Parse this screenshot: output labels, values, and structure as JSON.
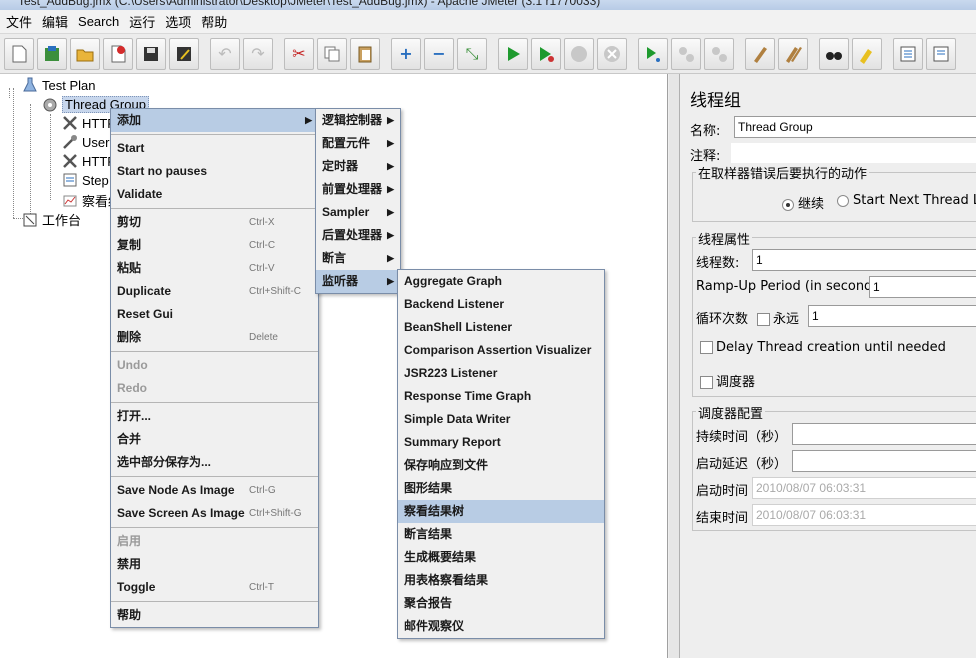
{
  "window": {
    "title": "Test_AddBug.jmx (C:\\Users\\Administrator\\Desktop\\JMeter\\Test_AddBug.jmx) - Apache JMeter (3.1 r1770033)"
  },
  "menubar": [
    "文件",
    "编辑",
    "Search",
    "运行",
    "选项",
    "帮助"
  ],
  "toolbar_icons": [
    "new-icon",
    "templates-icon",
    "open-icon",
    "close-icon",
    "save-icon",
    "save-as-icon",
    "undo-icon",
    "redo-icon",
    "cut-icon",
    "copy-icon",
    "paste-icon",
    "expand-icon",
    "collapse-icon",
    "toggle-icon",
    "start-icon",
    "start-no-pauses-icon",
    "stop-icon",
    "shutdown-icon",
    "remote-start-icon",
    "remote-stop-icon",
    "remote-shutdown-icon",
    "clear-icon",
    "clear-all-icon",
    "search-icon",
    "reset-search-icon",
    "function-helper-icon",
    "help-icon"
  ],
  "tree": {
    "test_plan": "Test Plan",
    "thread_group": "Thread Group",
    "children": [
      "HTTP",
      "User",
      "HTTP",
      "Step",
      "察看结"
    ],
    "workbench": "工作台"
  },
  "context_menu": {
    "items": [
      {
        "label": "添加",
        "submenu": true,
        "highlighted": true
      },
      {
        "sep": true
      },
      {
        "label": "Start"
      },
      {
        "label": "Start no pauses"
      },
      {
        "label": "Validate"
      },
      {
        "sep": true
      },
      {
        "label": "剪切",
        "shortcut": "Ctrl-X"
      },
      {
        "label": "复制",
        "shortcut": "Ctrl-C"
      },
      {
        "label": "粘贴",
        "shortcut": "Ctrl-V"
      },
      {
        "label": "Duplicate",
        "shortcut": "Ctrl+Shift-C"
      },
      {
        "label": "Reset Gui"
      },
      {
        "label": "删除",
        "shortcut": "Delete"
      },
      {
        "sep": true
      },
      {
        "label": "Undo",
        "disabled": true
      },
      {
        "label": "Redo",
        "disabled": true
      },
      {
        "sep": true
      },
      {
        "label": "打开..."
      },
      {
        "label": "合并"
      },
      {
        "label": "选中部分保存为..."
      },
      {
        "sep": true
      },
      {
        "label": "Save Node As Image",
        "shortcut": "Ctrl-G"
      },
      {
        "label": "Save Screen As Image",
        "shortcut": "Ctrl+Shift-G"
      },
      {
        "sep": true
      },
      {
        "label": "启用",
        "disabled": true
      },
      {
        "label": "禁用"
      },
      {
        "label": "Toggle",
        "shortcut": "Ctrl-T"
      },
      {
        "sep": true
      },
      {
        "label": "帮助"
      }
    ]
  },
  "add_submenu": {
    "items": [
      {
        "label": "逻辑控制器",
        "submenu": true
      },
      {
        "label": "配置元件",
        "submenu": true
      },
      {
        "label": "定时器",
        "submenu": true
      },
      {
        "label": "前置处理器",
        "submenu": true
      },
      {
        "label": "Sampler",
        "submenu": true
      },
      {
        "label": "后置处理器",
        "submenu": true
      },
      {
        "label": "断言",
        "submenu": true
      },
      {
        "label": "监听器",
        "submenu": true,
        "highlighted": true
      }
    ]
  },
  "listener_submenu": {
    "items": [
      {
        "label": "Aggregate Graph"
      },
      {
        "label": "Backend Listener"
      },
      {
        "label": "BeanShell Listener"
      },
      {
        "label": "Comparison Assertion Visualizer"
      },
      {
        "label": "JSR223 Listener"
      },
      {
        "label": "Response Time Graph"
      },
      {
        "label": "Simple Data Writer"
      },
      {
        "label": "Summary Report"
      },
      {
        "label": "保存响应到文件"
      },
      {
        "label": "图形结果"
      },
      {
        "label": "察看结果树",
        "highlighted": true
      },
      {
        "label": "断言结果"
      },
      {
        "label": "生成概要结果"
      },
      {
        "label": "用表格察看结果"
      },
      {
        "label": "聚合报告"
      },
      {
        "label": "邮件观察仪"
      }
    ]
  },
  "panel": {
    "title": "线程组",
    "name_label": "名称:",
    "name_value": "Thread Group",
    "comment_label": "注释:",
    "error_legend": "在取样器错误后要执行的动作",
    "continue_label": "继续",
    "next_loop_label": "Start Next Thread Loop",
    "props_legend": "线程属性",
    "threads_label": "线程数:",
    "threads_value": "1",
    "rampup_label": "Ramp-Up Period (in seconds):",
    "rampup_value": "1",
    "loop_label": "循环次数",
    "forever_label": "永远",
    "loop_value": "1",
    "delay_label": "Delay Thread creation until needed",
    "scheduler_label": "调度器",
    "sched_legend": "调度器配置",
    "duration_label": "持续时间（秒）",
    "delay_start_label": "启动延迟（秒）",
    "start_label": "启动时间",
    "start_value": "2010/08/07 06:03:31",
    "end_label": "结束时间",
    "end_value": "2010/08/07 06:03:31"
  }
}
